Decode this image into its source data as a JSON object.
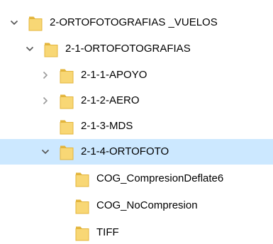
{
  "colors": {
    "selected_bg": "#cce8ff",
    "folder_fill": "#f8d775",
    "folder_edge": "#e3b53c",
    "chevron": "#555555",
    "chevron_light": "#9a9a9a"
  },
  "tree": {
    "nodes": [
      {
        "label": "2-ORTOFOTOGRAFIAS _VUELOS",
        "level": 0,
        "expander": "expanded",
        "selected": false,
        "icon": "folder-icon"
      },
      {
        "label": "2-1-ORTOFOTOGRAFIAS",
        "level": 1,
        "expander": "expanded",
        "selected": false,
        "icon": "folder-icon"
      },
      {
        "label": "2-1-1-APOYO",
        "level": 2,
        "expander": "collapsed",
        "selected": false,
        "icon": "folder-icon"
      },
      {
        "label": "2-1-2-AERO",
        "level": 2,
        "expander": "collapsed",
        "selected": false,
        "icon": "folder-icon"
      },
      {
        "label": "2-1-3-MDS",
        "level": 2,
        "expander": "none",
        "selected": false,
        "icon": "folder-icon"
      },
      {
        "label": "2-1-4-ORTOFOTO",
        "level": 2,
        "expander": "expanded",
        "selected": true,
        "icon": "folder-icon"
      },
      {
        "label": "COG_CompresionDeflate6",
        "level": 3,
        "expander": "none",
        "selected": false,
        "icon": "folder-icon"
      },
      {
        "label": "COG_NoCompresion",
        "level": 3,
        "expander": "none",
        "selected": false,
        "icon": "folder-icon"
      },
      {
        "label": "TIFF",
        "level": 3,
        "expander": "none",
        "selected": false,
        "icon": "folder-icon"
      }
    ]
  }
}
